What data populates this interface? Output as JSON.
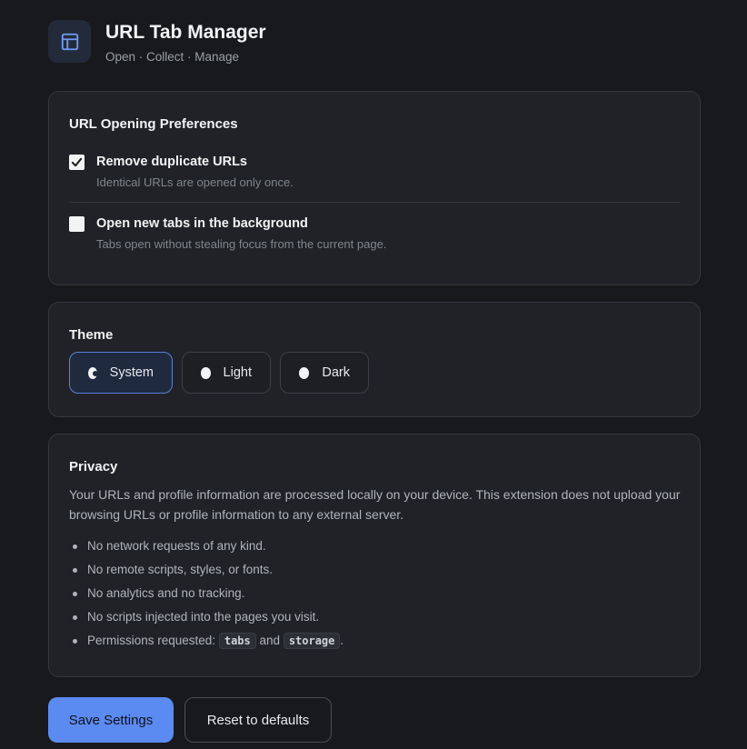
{
  "header": {
    "title": "URL Tab Manager",
    "subtitle": "Open · Collect · Manage",
    "logo_icon": "layout-panel-icon"
  },
  "preferences": {
    "title": "URL Opening Preferences",
    "items": [
      {
        "label": "Remove duplicate URLs",
        "description": "Identical URLs are opened only once.",
        "checked": true
      },
      {
        "label": "Open new tabs in the background",
        "description": "Tabs open without stealing focus from the current page.",
        "checked": false
      }
    ]
  },
  "theme": {
    "title": "Theme",
    "options": [
      {
        "label": "System",
        "selected": true
      },
      {
        "label": "Light",
        "selected": false
      },
      {
        "label": "Dark",
        "selected": false
      }
    ]
  },
  "privacy": {
    "title": "Privacy",
    "description": "Your URLs and profile information are processed locally on your device. This extension does not upload your browsing URLs or profile information to any external server.",
    "bullets": [
      "No network requests of any kind.",
      "No remote scripts, styles, or fonts.",
      "No analytics and no tracking.",
      "No scripts injected into the pages you visit."
    ],
    "permissions": {
      "prefix": "Permissions requested:",
      "perm1": "tabs",
      "joiner": "and",
      "perm2": "storage",
      "suffix": "."
    }
  },
  "actions": {
    "save_label": "Save Settings",
    "reset_label": "Reset to defaults"
  },
  "colors": {
    "accent": "#5b8af0",
    "background": "#18191c",
    "card": "#202227"
  }
}
